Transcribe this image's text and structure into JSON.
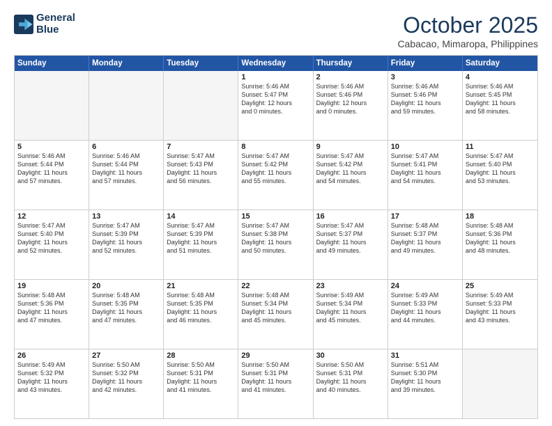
{
  "logo": {
    "line1": "General",
    "line2": "Blue"
  },
  "title": "October 2025",
  "subtitle": "Cabacao, Mimaropa, Philippines",
  "header_days": [
    "Sunday",
    "Monday",
    "Tuesday",
    "Wednesday",
    "Thursday",
    "Friday",
    "Saturday"
  ],
  "weeks": [
    [
      {
        "day": "",
        "info": ""
      },
      {
        "day": "",
        "info": ""
      },
      {
        "day": "",
        "info": ""
      },
      {
        "day": "1",
        "info": "Sunrise: 5:46 AM\nSunset: 5:47 PM\nDaylight: 12 hours\nand 0 minutes."
      },
      {
        "day": "2",
        "info": "Sunrise: 5:46 AM\nSunset: 5:46 PM\nDaylight: 12 hours\nand 0 minutes."
      },
      {
        "day": "3",
        "info": "Sunrise: 5:46 AM\nSunset: 5:46 PM\nDaylight: 11 hours\nand 59 minutes."
      },
      {
        "day": "4",
        "info": "Sunrise: 5:46 AM\nSunset: 5:45 PM\nDaylight: 11 hours\nand 58 minutes."
      }
    ],
    [
      {
        "day": "5",
        "info": "Sunrise: 5:46 AM\nSunset: 5:44 PM\nDaylight: 11 hours\nand 57 minutes."
      },
      {
        "day": "6",
        "info": "Sunrise: 5:46 AM\nSunset: 5:44 PM\nDaylight: 11 hours\nand 57 minutes."
      },
      {
        "day": "7",
        "info": "Sunrise: 5:47 AM\nSunset: 5:43 PM\nDaylight: 11 hours\nand 56 minutes."
      },
      {
        "day": "8",
        "info": "Sunrise: 5:47 AM\nSunset: 5:42 PM\nDaylight: 11 hours\nand 55 minutes."
      },
      {
        "day": "9",
        "info": "Sunrise: 5:47 AM\nSunset: 5:42 PM\nDaylight: 11 hours\nand 54 minutes."
      },
      {
        "day": "10",
        "info": "Sunrise: 5:47 AM\nSunset: 5:41 PM\nDaylight: 11 hours\nand 54 minutes."
      },
      {
        "day": "11",
        "info": "Sunrise: 5:47 AM\nSunset: 5:40 PM\nDaylight: 11 hours\nand 53 minutes."
      }
    ],
    [
      {
        "day": "12",
        "info": "Sunrise: 5:47 AM\nSunset: 5:40 PM\nDaylight: 11 hours\nand 52 minutes."
      },
      {
        "day": "13",
        "info": "Sunrise: 5:47 AM\nSunset: 5:39 PM\nDaylight: 11 hours\nand 52 minutes."
      },
      {
        "day": "14",
        "info": "Sunrise: 5:47 AM\nSunset: 5:39 PM\nDaylight: 11 hours\nand 51 minutes."
      },
      {
        "day": "15",
        "info": "Sunrise: 5:47 AM\nSunset: 5:38 PM\nDaylight: 11 hours\nand 50 minutes."
      },
      {
        "day": "16",
        "info": "Sunrise: 5:47 AM\nSunset: 5:37 PM\nDaylight: 11 hours\nand 49 minutes."
      },
      {
        "day": "17",
        "info": "Sunrise: 5:48 AM\nSunset: 5:37 PM\nDaylight: 11 hours\nand 49 minutes."
      },
      {
        "day": "18",
        "info": "Sunrise: 5:48 AM\nSunset: 5:36 PM\nDaylight: 11 hours\nand 48 minutes."
      }
    ],
    [
      {
        "day": "19",
        "info": "Sunrise: 5:48 AM\nSunset: 5:36 PM\nDaylight: 11 hours\nand 47 minutes."
      },
      {
        "day": "20",
        "info": "Sunrise: 5:48 AM\nSunset: 5:35 PM\nDaylight: 11 hours\nand 47 minutes."
      },
      {
        "day": "21",
        "info": "Sunrise: 5:48 AM\nSunset: 5:35 PM\nDaylight: 11 hours\nand 46 minutes."
      },
      {
        "day": "22",
        "info": "Sunrise: 5:48 AM\nSunset: 5:34 PM\nDaylight: 11 hours\nand 45 minutes."
      },
      {
        "day": "23",
        "info": "Sunrise: 5:49 AM\nSunset: 5:34 PM\nDaylight: 11 hours\nand 45 minutes."
      },
      {
        "day": "24",
        "info": "Sunrise: 5:49 AM\nSunset: 5:33 PM\nDaylight: 11 hours\nand 44 minutes."
      },
      {
        "day": "25",
        "info": "Sunrise: 5:49 AM\nSunset: 5:33 PM\nDaylight: 11 hours\nand 43 minutes."
      }
    ],
    [
      {
        "day": "26",
        "info": "Sunrise: 5:49 AM\nSunset: 5:32 PM\nDaylight: 11 hours\nand 43 minutes."
      },
      {
        "day": "27",
        "info": "Sunrise: 5:50 AM\nSunset: 5:32 PM\nDaylight: 11 hours\nand 42 minutes."
      },
      {
        "day": "28",
        "info": "Sunrise: 5:50 AM\nSunset: 5:31 PM\nDaylight: 11 hours\nand 41 minutes."
      },
      {
        "day": "29",
        "info": "Sunrise: 5:50 AM\nSunset: 5:31 PM\nDaylight: 11 hours\nand 41 minutes."
      },
      {
        "day": "30",
        "info": "Sunrise: 5:50 AM\nSunset: 5:31 PM\nDaylight: 11 hours\nand 40 minutes."
      },
      {
        "day": "31",
        "info": "Sunrise: 5:51 AM\nSunset: 5:30 PM\nDaylight: 11 hours\nand 39 minutes."
      },
      {
        "day": "",
        "info": ""
      }
    ]
  ]
}
